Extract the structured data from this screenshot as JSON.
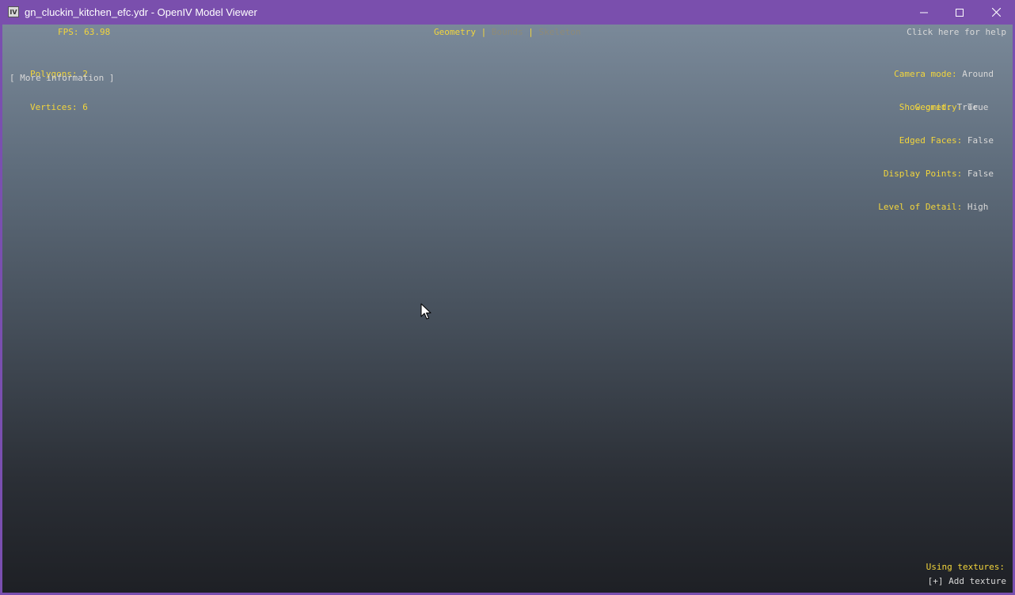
{
  "window": {
    "title": "gn_cluckin_kitchen_efc.ydr - OpenIV Model Viewer",
    "app_icon_text": "IV",
    "accent_color": "#7a4fad"
  },
  "hud": {
    "fps": "FPS: 63.98",
    "polygons_label": "Polygons:",
    "polygons_value": "2",
    "vertices_label": "Vertices:",
    "vertices_value": "6",
    "more_info": "[ More information ]",
    "modes": {
      "geometry": "Geometry",
      "bounds": "Bounds",
      "skeleton": "Skeleton",
      "separator": "|"
    },
    "help": "Click here for help",
    "camera_mode_label": "Camera mode:",
    "camera_mode_value": "Around",
    "show_grid_label": "Show grid:",
    "show_grid_value": "True",
    "geometry_label": "Geometry:",
    "geometry_value": "True",
    "edged_faces_label": "Edged Faces:",
    "edged_faces_value": "False",
    "display_points_label": "Display Points:",
    "display_points_value": "False",
    "lod_label": "Level of Detail:",
    "lod_value": "High",
    "using_textures": "Using textures:",
    "add_texture": "[+] Add texture",
    "colors": {
      "label": "#f2d53c",
      "value": "#d8d8d8",
      "inactive": "#8e8a78"
    }
  }
}
